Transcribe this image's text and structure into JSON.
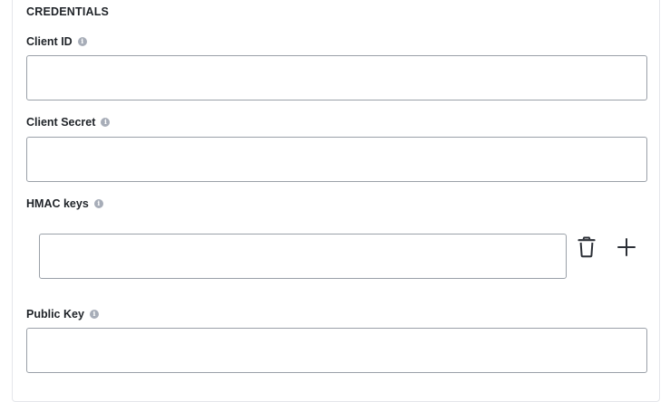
{
  "section": {
    "title": "CREDENTIALS"
  },
  "fields": {
    "client_id": {
      "label": "Client ID",
      "value": "",
      "placeholder": ""
    },
    "client_secret": {
      "label": "Client Secret",
      "value": "",
      "placeholder": ""
    },
    "hmac_keys": {
      "label": "HMAC keys",
      "items": [
        {
          "value": "",
          "placeholder": ""
        }
      ]
    },
    "public_key": {
      "label": "Public Key",
      "value": "",
      "placeholder": ""
    }
  },
  "icons": {
    "info": "info-icon",
    "delete": "trash-icon",
    "add": "plus-icon"
  },
  "colors": {
    "border": "#9aa0a8",
    "info_icon": "#a7adb8",
    "text": "#1f2328",
    "icon": "#2b2f36"
  }
}
